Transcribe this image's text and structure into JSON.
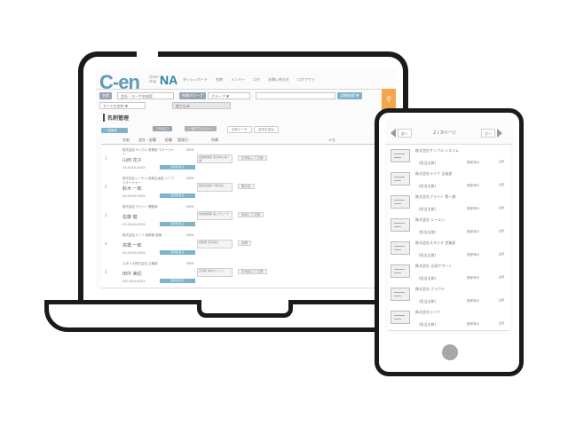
{
  "laptop": {
    "logo": "C-en",
    "logo_sub": "clean ship",
    "logo_mark": "NA",
    "nav": [
      "ダッシュボード",
      "名刺",
      "メンバー",
      "ログ",
      "お問い合わせ",
      "ログアウト"
    ],
    "filters": {
      "row1_label": "名前",
      "row1_value": "会社・ユーザ名検索",
      "row1_label2": "所属グループ",
      "row1_value2": "グループ ▼",
      "row1_search_btn": "詳細検索 ▼",
      "row2_value": "すべての名刺 ▼",
      "row2_btn": "絞り込み",
      "search_icon": "magnifier-icon"
    },
    "page_title": "名刺管理",
    "toolbar": [
      "一括操作",
      "CSV出力",
      "一括ダウンロード",
      "名刺データ",
      "名刺を追加"
    ],
    "table_headers": [
      "名前",
      "会社・部署",
      "役職",
      "登録日",
      "所属",
      "メモ"
    ],
    "rows": [
      {
        "num": "1",
        "company": "株式会社サンプル 営業部 マネージャー",
        "person": "山田 花子",
        "tel": "03-XXXX-XXXX",
        "tag": "NEW",
        "btn": "名刺を見る",
        "org": "営業推進部 東京本社 第一課",
        "note": "定例会にて交換"
      },
      {
        "num": "2",
        "company": "株式会社シーエン 経営企画室 シニアマネージャー",
        "person": "鈴木 一郎",
        "tel": "06-XXXX-XXXX",
        "tag": "NEW",
        "btn": "名刺を見る",
        "org": "経営企画部 大阪支社",
        "note": "展示会"
      },
      {
        "num": "3",
        "company": "株式会社ブライト 開発部",
        "person": "佐藤 健",
        "tel": "03-XXXX-XXXX",
        "tag": "NEW",
        "btn": "名刺を見る",
        "org": "技術開発部 第二グループ",
        "note": "商談にて交換"
      },
      {
        "num": "4",
        "company": "株式会社ライフ 総務部 部長",
        "person": "高橋 一郎",
        "tel": "03-XXXX-XXXX",
        "tag": "NEW",
        "btn": "名刺を見る",
        "org": "総務部 東京本社",
        "note": "訪問"
      },
      {
        "num": "5",
        "company": "スタジオ株式会社 広報部",
        "person": "田中 美紀",
        "tel": "045-XXX-XXXX",
        "tag": "NEW",
        "btn": "名刺を見る",
        "org": "広報部 横浜オフィス",
        "note": "定例会にて交換"
      }
    ]
  },
  "phone": {
    "prev": "前へ",
    "page": "2 / 3ページ",
    "next": "次へ",
    "cards": [
      {
        "company": "株式会社サンプル システム",
        "name": "(担当太郎)",
        "status": "登録済み",
        "flag": "Off"
      },
      {
        "company": "株式会社ライフ 企画部",
        "name": "(担当太郎)",
        "status": "登録済み",
        "flag": "Off"
      },
      {
        "company": "株式会社ブライト 第一課",
        "name": "(担当太郎)",
        "status": "登録済み",
        "flag": "Off"
      },
      {
        "company": "株式会社 シーエン",
        "name": "(担当太郎)",
        "status": "登録済み",
        "flag": "Off"
      },
      {
        "company": "株式会社スタジオ 営業部",
        "name": "(担当太郎)",
        "status": "登録済み",
        "flag": "Off"
      },
      {
        "company": "株式会社 企画サポート",
        "name": "(担当太郎)",
        "status": "登録済み",
        "flag": "Off"
      },
      {
        "company": "株式会社 クラウド",
        "name": "(担当太郎)",
        "status": "登録済み",
        "flag": "Off"
      },
      {
        "company": "株式会社ライフ",
        "name": "(担当太郎)",
        "status": "登録済み",
        "flag": "Off"
      }
    ]
  }
}
